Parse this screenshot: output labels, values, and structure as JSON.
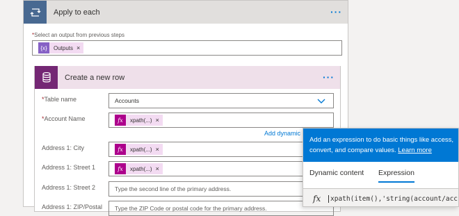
{
  "loop": {
    "title": "Apply to each",
    "menu_label": "···",
    "select_label": "Select an output from previous steps",
    "required_mark": "*",
    "output_token": {
      "label": "Outputs",
      "remove": "×",
      "icon": "braces-icon"
    }
  },
  "action": {
    "title": "Create a new row",
    "menu_label": "···",
    "fields": [
      {
        "label": "Table name",
        "required": true,
        "value": "Accounts",
        "type": "dropdown"
      },
      {
        "label": "Account Name",
        "required": true,
        "token": "xpath(...)",
        "token_remove": "×",
        "type": "token"
      },
      {
        "label": "Address 1: City",
        "required": false,
        "token": "xpath(...)",
        "token_remove": "×",
        "type": "token"
      },
      {
        "label": "Address 1: Street 1",
        "required": false,
        "token": "xpath(...)",
        "token_remove": "×",
        "type": "token"
      },
      {
        "label": "Address 1: Street 2",
        "required": false,
        "placeholder": "Type the second line of the primary address.",
        "type": "text"
      },
      {
        "label": "Address 1: ZIP/Postal",
        "required": false,
        "placeholder": "Type the ZIP Code or postal code for the primary address.",
        "type": "text"
      }
    ],
    "add_dynamic": "Add dynamic"
  },
  "popup": {
    "header_line1": "Add an expression to do basic things like access,",
    "header_line2": "convert, and compare values.",
    "learn_more": "Learn more",
    "tabs": [
      "Dynamic content",
      "Expression"
    ],
    "active_tab": "Expression",
    "fx_label": "fx",
    "expression": "xpath(item(),'string(account/acc"
  },
  "colors": {
    "loop_icon": "#486991",
    "action_icon": "#742774",
    "token_bg": "#f3dbf2",
    "accent": "#0078d4"
  }
}
